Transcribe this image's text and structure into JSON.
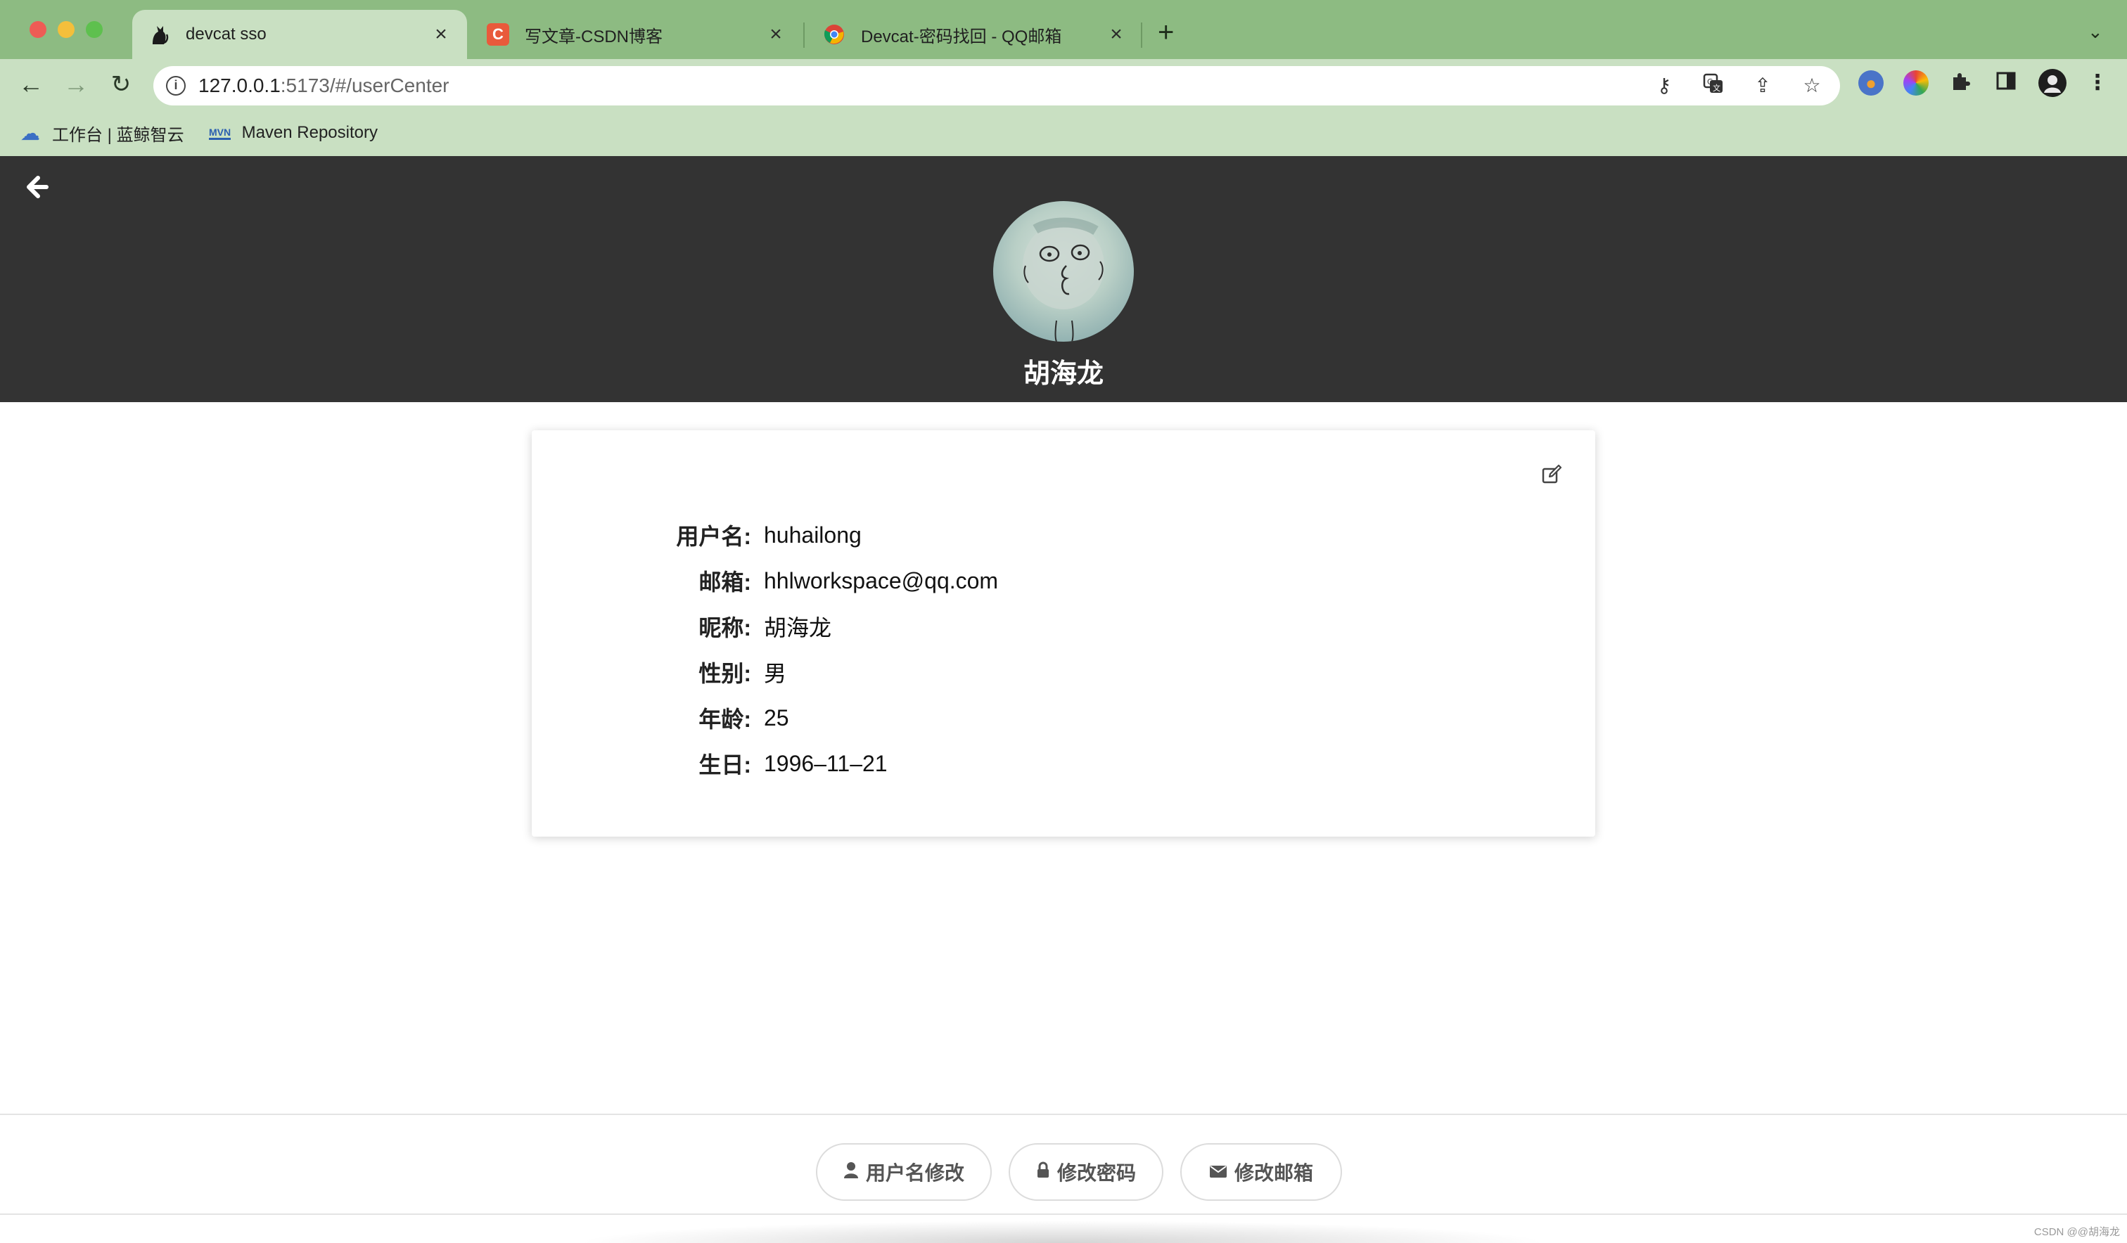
{
  "browser": {
    "tabs": [
      {
        "title": "devcat sso",
        "favicon": "cat-icon",
        "active": true
      },
      {
        "title": "写文章-CSDN博客",
        "favicon": "csdn-icon",
        "active": false
      },
      {
        "title": "Devcat-密码找回 - QQ邮箱",
        "favicon": "chrome-icon",
        "active": false
      }
    ],
    "address": {
      "host": "127.0.0.1",
      "rest": ":5173/#/userCenter"
    },
    "bookmarks": [
      {
        "label": "工作台 | 蓝鲸智云",
        "icon": "cloud-icon"
      },
      {
        "label": "Maven Repository",
        "icon": "mvn-icon",
        "icon_text": "MVN"
      }
    ]
  },
  "profile": {
    "name": "胡海龙"
  },
  "info": [
    {
      "label": "用户名:",
      "value": "huhailong"
    },
    {
      "label": "邮箱:",
      "value": "hhlworkspace@qq.com"
    },
    {
      "label": "昵称:",
      "value": "胡海龙"
    },
    {
      "label": "性别:",
      "value": "男"
    },
    {
      "label": "年龄:",
      "value": "25"
    },
    {
      "label": "生日:",
      "value": "1996–11–21"
    }
  ],
  "footer": {
    "buttons": [
      {
        "label": "用户名修改",
        "icon": "user-icon"
      },
      {
        "label": "修改密码",
        "icon": "lock-icon"
      },
      {
        "label": "修改邮箱",
        "icon": "envelope-icon"
      }
    ]
  },
  "watermark": "CSDN @@胡海龙",
  "colors": {
    "tab_strip": "#8dbb82",
    "toolbar": "#c9e0c2",
    "header_bg": "#333333",
    "accent_text": "#ffffff"
  }
}
